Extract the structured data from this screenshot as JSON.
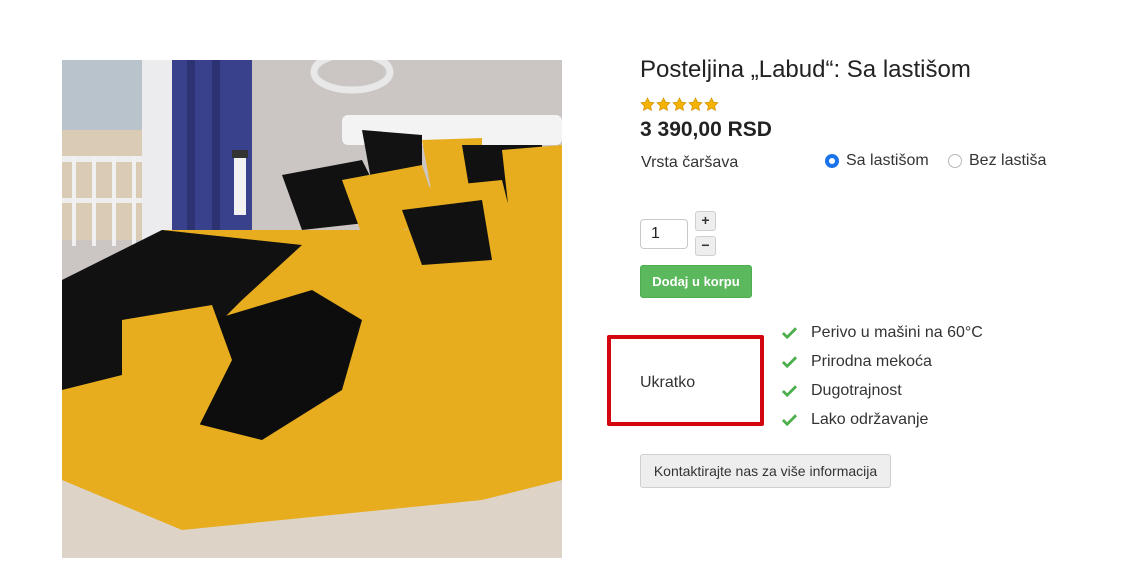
{
  "product": {
    "image_alt": "Posteljina Labud",
    "title": "Posteljina „Labud“: Sa lastišom",
    "rating_stars": 5,
    "rating_max": 5,
    "price": "3 390,00 RSD"
  },
  "variant": {
    "label": "Vrsta čaršava",
    "options": [
      {
        "label": "Sa lastišom",
        "selected": true
      },
      {
        "label": "Bez lastiša",
        "selected": false
      }
    ]
  },
  "quantity": {
    "value": "1",
    "increase_label": "+",
    "decrease_label": "−"
  },
  "cart": {
    "add_label": "Dodaj u korpu"
  },
  "summary": {
    "label": "Ukratko",
    "features": [
      "Perivo u mašini na 60°C",
      "Prirodna mekoća",
      "Dugotrajnost",
      "Lako održavanje"
    ]
  },
  "contact": {
    "label": "Kontaktirajte nas za više informacija"
  },
  "colors": {
    "accent_blue": "#1a73e8",
    "cart_green": "#5cb85c",
    "check_green": "#4cae4c",
    "highlight_red": "#d3050f",
    "star_gold": "#f5b301"
  },
  "icons": {
    "star": "star-icon",
    "check": "check-icon"
  }
}
